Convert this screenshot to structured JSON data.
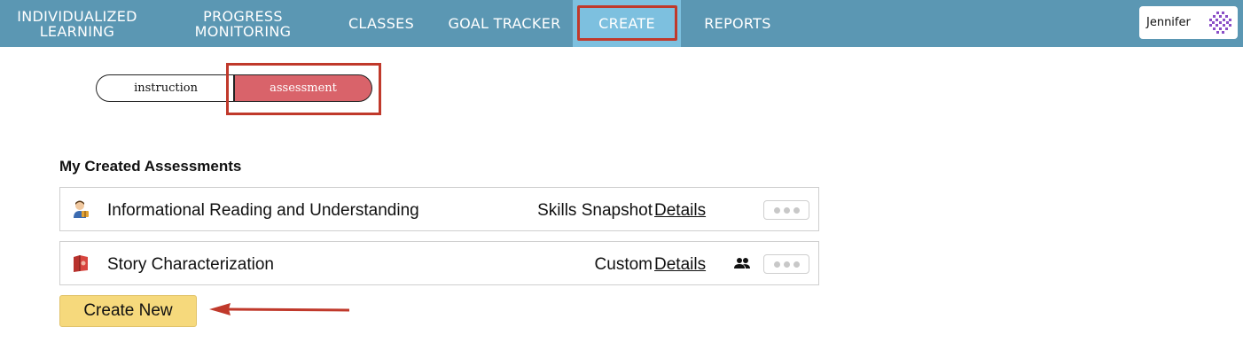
{
  "nav": {
    "individualized": [
      "INDIVIDUALIZED",
      "LEARNING"
    ],
    "progress": [
      "PROGRESS",
      "MONITORING"
    ],
    "classes": "CLASSES",
    "goal_tracker": "GOAL TRACKER",
    "create": "CREATE",
    "reports": "REPORTS",
    "active": "CREATE"
  },
  "user": {
    "name": "Jennifer",
    "avatar_icon": "avatar-icon"
  },
  "toggle": {
    "instruction": "instruction",
    "assessment": "assessment",
    "selected": "assessment"
  },
  "section": {
    "title": "My Created Assessments",
    "assessments": [
      {
        "name": "Informational Reading and Understanding",
        "type": "Skills Snapshot",
        "details": "Details",
        "icon": "student-reading-icon",
        "shared": false
      },
      {
        "name": "Story Characterization",
        "type": "Custom",
        "details": "Details",
        "icon": "book-icon",
        "shared": true
      }
    ]
  },
  "create_button": "Create New",
  "colors": {
    "nav_bg": "#5b97b3",
    "nav_active_bg": "#7dc0df",
    "toggle_selected": "#d9636a",
    "annotation_red": "#c0392b",
    "create_button_bg": "#f6d97c"
  }
}
